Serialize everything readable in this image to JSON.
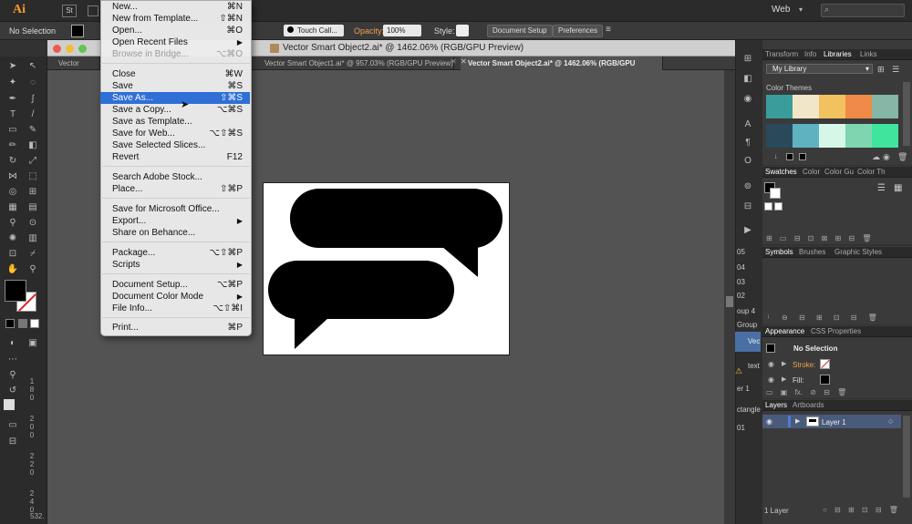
{
  "app": {
    "logo_text": "Ai",
    "workspace": "Web"
  },
  "control_bar": {
    "selection": "No Selection",
    "brush": "Touch Call...",
    "opacity_label": "Opacity:",
    "opacity_value": "100%",
    "style_label": "Style:",
    "document_setup": "Document Setup",
    "preferences": "Preferences"
  },
  "document": {
    "window_title": "Vector Smart Object2.ai* @ 1462.06% (RGB/GPU Preview)",
    "tabs": [
      {
        "label": "Vector Smart"
      },
      {
        "label": "Vector Smart Object1.ai* @ 957.03% (RGB/GPU Preview)"
      },
      {
        "label": "Vector Smart Object2.ai* @ 1462.06% (RGB/GPU Preview)"
      }
    ],
    "zoom_readout": "532."
  },
  "file_menu": {
    "items": [
      {
        "label": "New...",
        "shortcut": "⌘N"
      },
      {
        "label": "New from Template...",
        "shortcut": "⇧⌘N"
      },
      {
        "label": "Open...",
        "shortcut": "⌘O"
      },
      {
        "label": "Open Recent Files",
        "submenu": "▶"
      },
      {
        "label": "Browse in Bridge...",
        "shortcut": "⌥⌘O"
      },
      {
        "label": "Close",
        "shortcut": "⌘W"
      },
      {
        "label": "Save",
        "shortcut": "⌘S"
      },
      {
        "label": "Save As...",
        "shortcut": "⇧⌘S"
      },
      {
        "label": "Save a Copy...",
        "shortcut": "⌥⌘S"
      },
      {
        "label": "Save as Template..."
      },
      {
        "label": "Save for Web...",
        "shortcut": "⌥⇧⌘S"
      },
      {
        "label": "Save Selected Slices..."
      },
      {
        "label": "Revert",
        "shortcut": "F12"
      },
      {
        "label": "Search Adobe Stock..."
      },
      {
        "label": "Place...",
        "shortcut": "⇧⌘P"
      },
      {
        "label": "Save for Microsoft Office..."
      },
      {
        "label": "Export...",
        "submenu": "▶"
      },
      {
        "label": "Share on Behance..."
      },
      {
        "label": "Package...",
        "shortcut": "⌥⇧⌘P"
      },
      {
        "label": "Scripts",
        "submenu": "▶"
      },
      {
        "label": "Document Setup...",
        "shortcut": "⌥⌘P"
      },
      {
        "label": "Document Color Mode",
        "submenu": "▶"
      },
      {
        "label": "File Info...",
        "shortcut": "⌥⇧⌘I"
      },
      {
        "label": "Print...",
        "shortcut": "⌘P"
      }
    ]
  },
  "libraries_panel": {
    "tabs": [
      "Transform",
      "Info",
      "Libraries",
      "Links"
    ],
    "library_name": "My Library",
    "section": "Color Themes",
    "theme_colors_row1": [
      "#3a9d9b",
      "#f1e6c7",
      "#f2c160",
      "#ef8a48",
      "#86b6a6"
    ],
    "theme_colors_row2": [
      "#2a4a5c",
      "#5fb3c1",
      "#d6f7e7",
      "#7ed6b1",
      "#3fe59c"
    ]
  },
  "swatches_panel": {
    "tabs": [
      "Swatches",
      "Color",
      "Color Gu",
      "Color Th"
    ]
  },
  "symbols_panel": {
    "tabs": [
      "Symbols",
      "Brushes",
      "Graphic Styles"
    ]
  },
  "appearance_panel": {
    "tabs": [
      "Appearance",
      "CSS Properties"
    ],
    "selection": "No Selection",
    "stroke_label": "Stroke:",
    "fill_label": "Fill:"
  },
  "layers_panel": {
    "tabs": [
      "Layers",
      "Artboards"
    ],
    "layer_name": "Layer 1",
    "footer": "1 Layer"
  },
  "collapsed_panel": {
    "labels": [
      "05",
      "04",
      "03",
      "02",
      "oup 4",
      "Group",
      "Vec",
      "text",
      "er 1",
      "ctangle",
      "01"
    ]
  },
  "ruler": {
    "ticks": [
      "1",
      "8",
      "0",
      "2",
      "0",
      "0",
      "2",
      "2",
      "0",
      "2",
      "4",
      "0"
    ]
  }
}
